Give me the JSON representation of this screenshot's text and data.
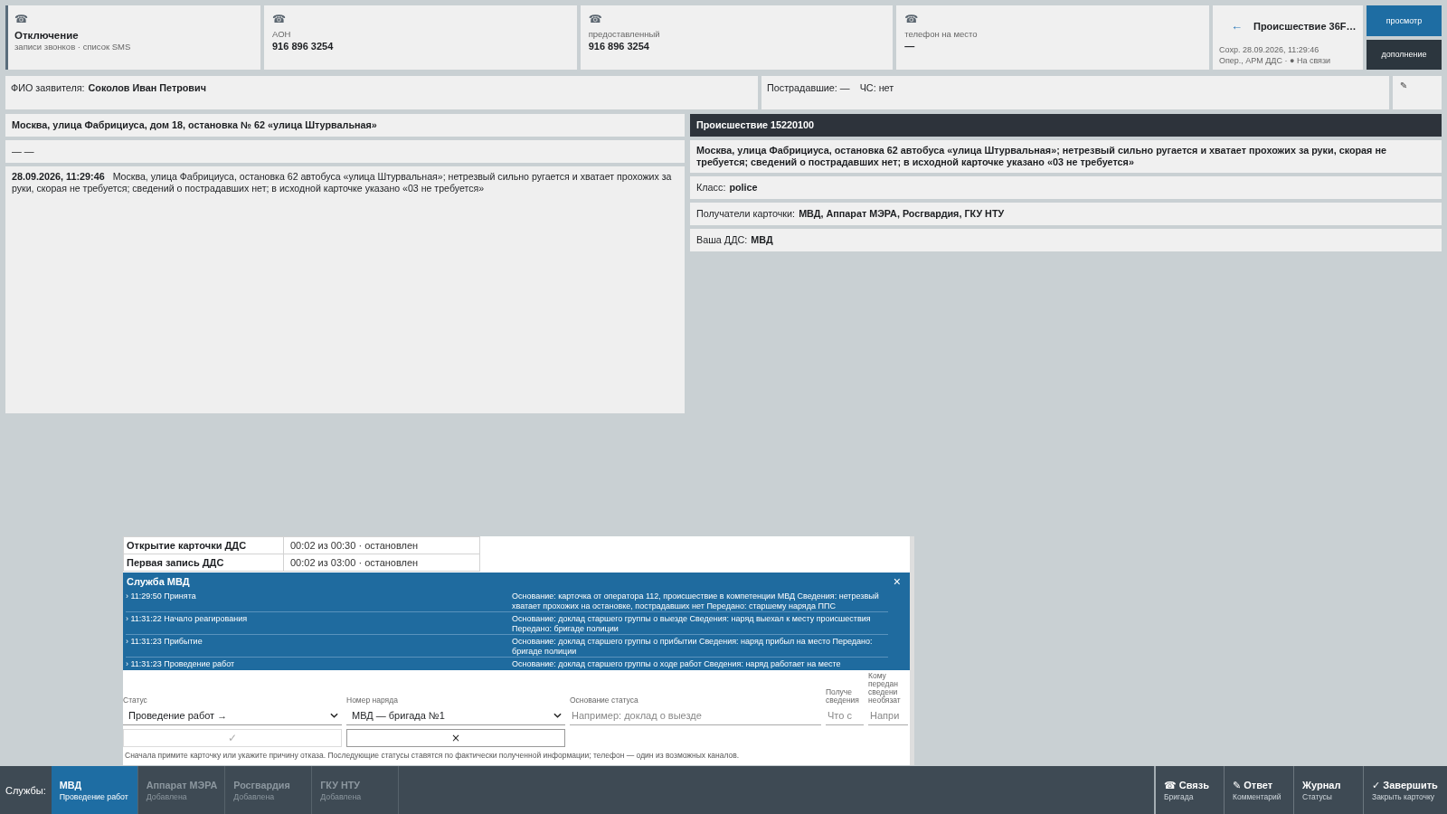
{
  "top_cards": [
    {
      "kind": "status",
      "icon": "☎",
      "title": "Отключение",
      "subtitle": "записи звонков · список SMS"
    },
    {
      "kind": "phone",
      "icon": "☎",
      "label": "АОН",
      "value": "916 896 3254"
    },
    {
      "kind": "phone",
      "icon": "☎",
      "label": "предоставленный",
      "value": "916 896 3254"
    },
    {
      "kind": "phone",
      "icon": "☎",
      "label": "телефон на место",
      "value": "—"
    }
  ],
  "incident_card": {
    "back": "←",
    "title": "Происшествие 36F…",
    "saved": "Сохр. 28.09.2026, 11:29:46",
    "operator": "Опер., АРМ ДДС · ● На связи"
  },
  "view_buttons": [
    {
      "label": "просмотр",
      "selected": true
    },
    {
      "label": "дополнение",
      "selected": false
    }
  ],
  "applicant": {
    "label": "ФИО заявителя:",
    "value": "Соколов Иван Петрович"
  },
  "casualties": "Пострадавшие: —",
  "emergency": "ЧС: нет",
  "edit": "✎",
  "address": "Москва, улица Фабрициуса, дом 18, остановка № 62 «улица Штурвальная»",
  "address_note": "— —",
  "narrative": {
    "time": "28.09.2026, 11:29:46",
    "text": "Москва, улица Фабрициуса, остановка 62 автобуса «улица Штурвальная»; нетрезвый сильно ругается и хватает прохожих за руки, скорая не требуется; сведений о пострадавших нет; в исходной карточке указано «03 не требуется»"
  },
  "incident": {
    "title": "Происшествие 15220100",
    "description": "Москва, улица Фабрициуса, остановка 62 автобуса «улица Штурвальная»; нетрезвый сильно ругается и хватает прохожих за руки, скорая не требуется; сведений о пострадавших нет; в исходной карточке указано «03 не требуется»",
    "fields": [
      {
        "label": "Класс:",
        "value": "police"
      },
      {
        "label": "Получатели карточки:",
        "value": "МВД, Аппарат МЭРА, Росгвардия, ГКУ НТУ"
      },
      {
        "label": "Ваша ДДС:",
        "value": "МВД"
      }
    ]
  },
  "dialog": {
    "timers": [
      {
        "label": "Открытие карточки ДДС",
        "value": "00:02 из 00:30 · остановлен"
      },
      {
        "label": "Первая запись ДДС",
        "value": "00:02 из 03:00 · остановлен"
      }
    ],
    "service": {
      "title": "Служба МВД",
      "close": "×",
      "log": [
        {
          "entry": "› 11:29:50 Принята",
          "details": "Основание: карточка от оператора 112, происшествие в компетенции МВД Сведения: нетрезвый хватает прохожих на остановке, пострадавших нет Передано: старшему наряда ППС"
        },
        {
          "entry": "› 11:31:22 Начало реагирования",
          "details": "Основание: доклад старшего группы о выезде Сведения: наряд выехал к месту происшествия Передано: бригаде полиции"
        },
        {
          "entry": "› 11:31:23 Прибытие",
          "details": "Основание: доклад старшего группы о прибытии Сведения: наряд прибыл на место Передано: бригаде полиции"
        },
        {
          "entry": "› 11:31:23 Проведение работ",
          "details": "Основание: доклад старшего группы о ходе работ Сведения: наряд работает на месте"
        }
      ]
    },
    "form": {
      "fields": [
        {
          "kind": "select",
          "label": "Статус",
          "value": "Проведение работ →"
        },
        {
          "kind": "select",
          "label": "Номер наряда",
          "value": "МВД — бригада №1"
        },
        {
          "kind": "input",
          "label": "Основание статуса",
          "placeholder": "Например: доклад о выезде"
        },
        {
          "kind": "input",
          "label": "Получе сведения",
          "placeholder": "Что с"
        },
        {
          "kind": "input",
          "label": "Кому передан сведени необязат",
          "placeholder": "Напри"
        }
      ],
      "actions": [
        {
          "label": "✓",
          "disabled": true
        },
        {
          "label": "×",
          "disabled": false
        }
      ],
      "note": "Сначала примите карточку или укажите причину отказа. Последующие статусы ставятся по фактически полученной информации; телефон — один из возможных каналов."
    }
  },
  "bottom_bar": {
    "label": "Службы:",
    "services": [
      {
        "name": "МВД",
        "status": "Проведение работ",
        "selected": true
      },
      {
        "name": "Аппарат МЭРА",
        "status": "Добавлена",
        "selected": false
      },
      {
        "name": "Росгвардия",
        "status": "Добавлена",
        "selected": false
      },
      {
        "name": "ГКУ НТУ",
        "status": "Добавлена",
        "selected": false
      }
    ],
    "actions": [
      {
        "label": "☎ Связь",
        "sub": "Бригада"
      },
      {
        "label": "✎ Ответ",
        "sub": "Комментарий"
      },
      {
        "label": "Журнал",
        "sub": "Статусы"
      },
      {
        "label": "✓ Завершить",
        "sub": "Закрыть карточку"
      }
    ]
  }
}
